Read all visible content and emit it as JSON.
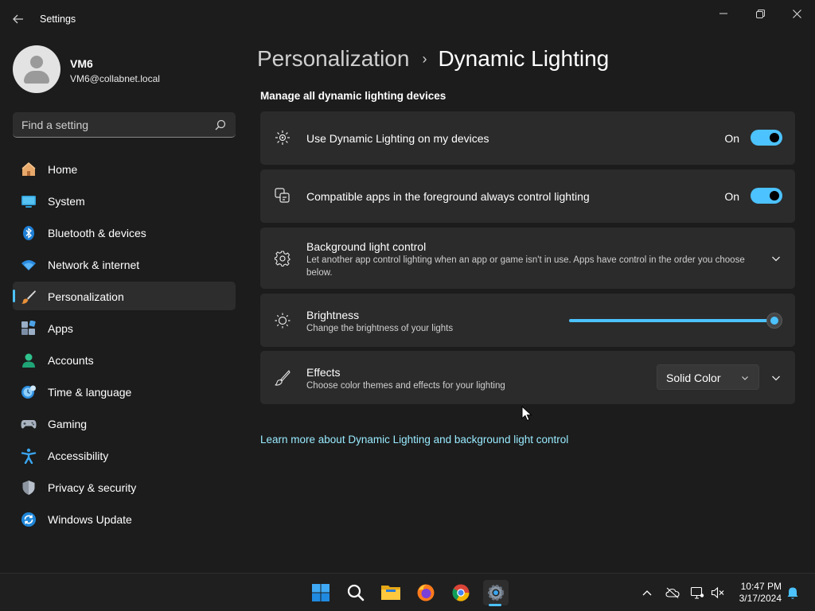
{
  "window": {
    "title": "Settings"
  },
  "profile": {
    "name": "VM6",
    "email": "VM6@collabnet.local"
  },
  "search": {
    "placeholder": "Find a setting"
  },
  "sidebar": {
    "items": [
      {
        "label": "Home",
        "icon": "home-icon"
      },
      {
        "label": "System",
        "icon": "system-icon"
      },
      {
        "label": "Bluetooth & devices",
        "icon": "bluetooth-icon"
      },
      {
        "label": "Network & internet",
        "icon": "wifi-icon"
      },
      {
        "label": "Personalization",
        "icon": "brush-icon",
        "active": true
      },
      {
        "label": "Apps",
        "icon": "apps-icon"
      },
      {
        "label": "Accounts",
        "icon": "accounts-icon"
      },
      {
        "label": "Time & language",
        "icon": "clock-globe-icon"
      },
      {
        "label": "Gaming",
        "icon": "gamepad-icon"
      },
      {
        "label": "Accessibility",
        "icon": "accessibility-icon"
      },
      {
        "label": "Privacy & security",
        "icon": "shield-icon"
      },
      {
        "label": "Windows Update",
        "icon": "update-icon"
      }
    ]
  },
  "breadcrumb": {
    "parent": "Personalization",
    "separator": "›",
    "current": "Dynamic Lighting"
  },
  "main": {
    "section_title": "Manage all dynamic lighting devices",
    "use_dynamic": {
      "title": "Use Dynamic Lighting on my devices",
      "state": "On",
      "enabled": true
    },
    "compatible_apps": {
      "title": "Compatible apps in the foreground always control lighting",
      "state": "On",
      "enabled": true
    },
    "background_control": {
      "title": "Background light control",
      "description": "Let another app control lighting when an app or game isn't in use. Apps have control in the order you choose below."
    },
    "brightness": {
      "title": "Brightness",
      "description": "Change the brightness of your lights",
      "value_percent": 100
    },
    "effects": {
      "title": "Effects",
      "description": "Choose color themes and effects for your lighting",
      "selected": "Solid Color"
    },
    "learn_more": "Learn more about Dynamic Lighting and background light control"
  },
  "taskbar": {
    "pinned": [
      "start-icon",
      "search-icon",
      "file-explorer-icon",
      "firefox-icon",
      "chrome-icon",
      "settings-icon"
    ],
    "active": "settings-icon"
  },
  "tray": {
    "time": "10:47 PM",
    "date": "3/17/2024"
  },
  "colors": {
    "accent": "#4cc2ff",
    "background": "#1c1c1c",
    "card": "#2b2b2b",
    "link": "#99ebff"
  }
}
